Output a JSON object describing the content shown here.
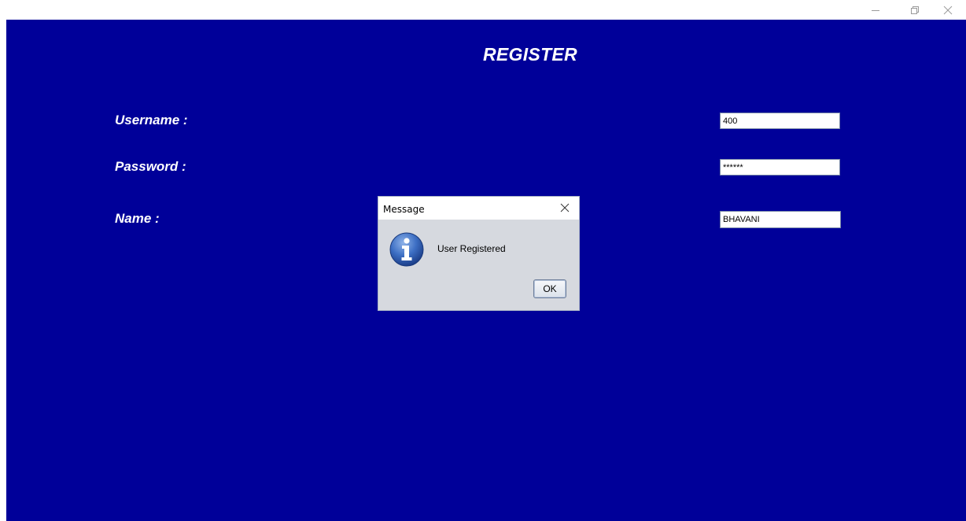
{
  "window": {
    "controls": {
      "minimize_icon": "minimize-icon",
      "maximize_icon": "restore-icon",
      "close_icon": "close-icon"
    }
  },
  "form": {
    "title": "REGISTER",
    "username_label": "Username :",
    "password_label": "Password :",
    "name_label": "Name :",
    "username_value": "400",
    "password_value": "******",
    "name_value": "BHAVANI",
    "background_color": "#000099"
  },
  "dialog": {
    "title": "Message",
    "message": "User Registered",
    "ok_label": "OK",
    "icon": "info-icon",
    "close_icon": "close-icon"
  }
}
